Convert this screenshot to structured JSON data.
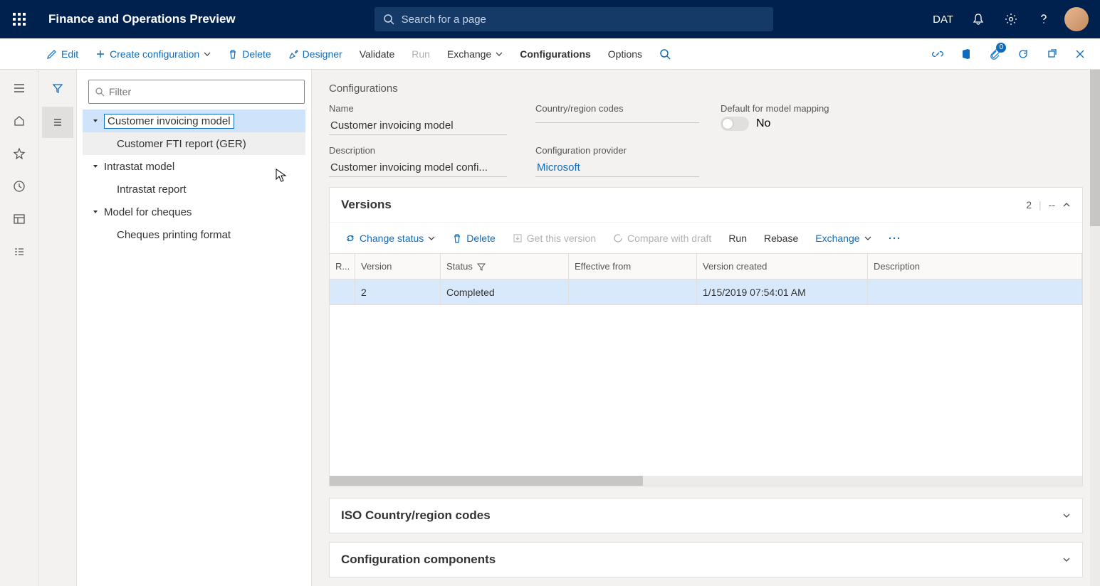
{
  "header": {
    "app_title": "Finance and Operations Preview",
    "search_placeholder": "Search for a page",
    "company": "DAT"
  },
  "actionbar": {
    "edit": "Edit",
    "create_config": "Create configuration",
    "delete": "Delete",
    "designer": "Designer",
    "validate": "Validate",
    "run": "Run",
    "exchange": "Exchange",
    "configurations": "Configurations",
    "options": "Options",
    "attachment_badge": "0"
  },
  "tree": {
    "filter_placeholder": "Filter",
    "nodes": [
      {
        "label": "Customer invoicing model",
        "parent": true
      },
      {
        "label": "Customer FTI report (GER)"
      },
      {
        "label": "Intrastat model",
        "parent": true
      },
      {
        "label": "Intrastat report"
      },
      {
        "label": "Model for cheques",
        "parent": true
      },
      {
        "label": "Cheques printing format"
      }
    ]
  },
  "details": {
    "page_heading": "Configurations",
    "name_label": "Name",
    "name_value": "Customer invoicing model",
    "region_label": "Country/region codes",
    "region_value": "",
    "default_model_label": "Default for model mapping",
    "default_model_value": "No",
    "desc_label": "Description",
    "desc_value": "Customer invoicing model confi...",
    "provider_label": "Configuration provider",
    "provider_value": "Microsoft"
  },
  "versions": {
    "title": "Versions",
    "count": "2",
    "dash": "--",
    "toolbar": {
      "change_status": "Change status",
      "delete": "Delete",
      "get_version": "Get this version",
      "compare": "Compare with draft",
      "run": "Run",
      "rebase": "Rebase",
      "exchange": "Exchange"
    },
    "columns": {
      "r": "R...",
      "version": "Version",
      "status": "Status",
      "effective_from": "Effective from",
      "version_created": "Version created",
      "description": "Description"
    },
    "rows": [
      {
        "version": "2",
        "status": "Completed",
        "effective_from": "",
        "version_created": "1/15/2019 07:54:01 AM",
        "description": ""
      }
    ]
  },
  "sections": {
    "iso": "ISO Country/region codes",
    "components": "Configuration components"
  }
}
